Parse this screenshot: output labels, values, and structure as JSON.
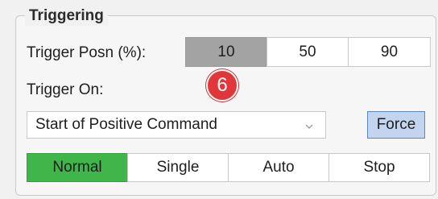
{
  "group": {
    "title": "Triggering"
  },
  "trigger_position": {
    "label": "Trigger Posn (%):",
    "options": [
      "10",
      "50",
      "90"
    ],
    "selected": "10"
  },
  "trigger_on": {
    "label": "Trigger On:",
    "selected_value": "Start of Positive Command",
    "force_label": "Force"
  },
  "callout": {
    "number": "6",
    "color": "#e2373a"
  },
  "mode": {
    "options": [
      "Normal",
      "Single",
      "Auto",
      "Stop"
    ],
    "selected": "Normal",
    "selected_color": "#3fb54a"
  },
  "icons": {
    "dropdown": "chevron-down-icon"
  }
}
